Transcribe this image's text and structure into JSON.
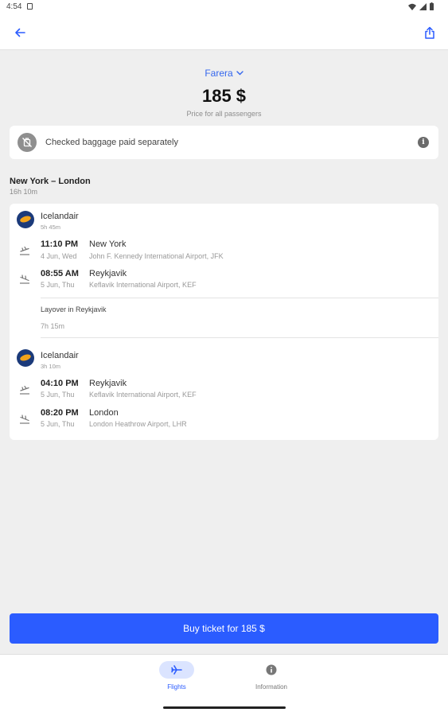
{
  "status_bar": {
    "time": "4:54"
  },
  "app_bar": {
    "back_icon": "arrow-left-icon",
    "share_icon": "share-icon"
  },
  "fare": {
    "name": "Farera",
    "price": "185 $",
    "caption": "Price for all passengers"
  },
  "baggage_notice": {
    "text": "Checked baggage paid separately",
    "icon": "no-baggage-icon"
  },
  "route": {
    "title": "New York – London",
    "duration": "16h 10m"
  },
  "legs": [
    {
      "airline": "Icelandair",
      "duration": "5h 45m",
      "departure": {
        "time": "11:10 PM",
        "city": "New York",
        "date": "4 Jun, Wed",
        "airport": "John F. Kennedy International Airport, JFK"
      },
      "arrival": {
        "time": "08:55 AM",
        "city": "Reykjavik",
        "date": "5 Jun, Thu",
        "airport": "Keflavik International Airport, KEF"
      }
    },
    {
      "airline": "Icelandair",
      "duration": "3h 10m",
      "departure": {
        "time": "04:10 PM",
        "city": "Reykjavik",
        "date": "5 Jun, Thu",
        "airport": "Keflavik International Airport, KEF"
      },
      "arrival": {
        "time": "08:20 PM",
        "city": "London",
        "date": "5 Jun, Thu",
        "airport": "London Heathrow Airport, LHR"
      }
    }
  ],
  "layover": {
    "label": "Layover in Reykjavik",
    "duration": "7h 15m"
  },
  "buy_button": {
    "label": "Buy ticket for 185 $"
  },
  "bottom_nav": {
    "items": [
      {
        "label": "Flights",
        "icon": "airplane-icon",
        "active": true
      },
      {
        "label": "Information",
        "icon": "info-icon",
        "active": false
      }
    ]
  },
  "colors": {
    "accent": "#2b5cff",
    "background": "#efefef",
    "card": "#ffffff"
  }
}
